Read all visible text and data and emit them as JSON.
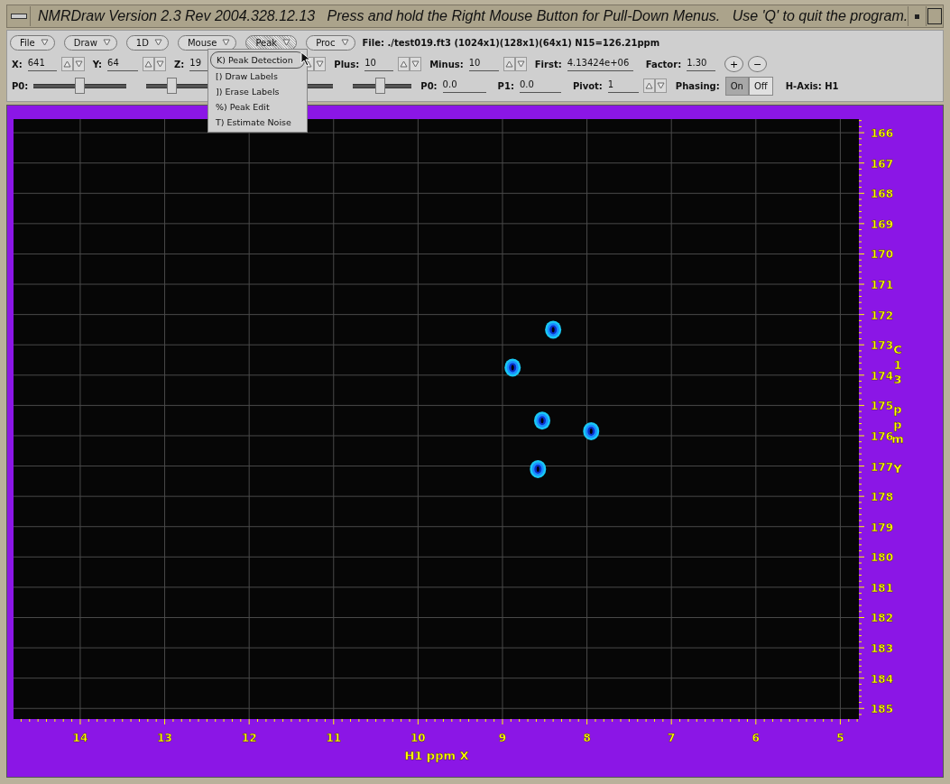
{
  "window": {
    "title": "NMRDraw Version 2.3 Rev 2004.328.12.13   Press and hold the Right Mouse Button for Pull-Down Menus.   Use 'Q' to quit the program."
  },
  "menus": [
    {
      "label": "File",
      "selected": false
    },
    {
      "label": "Draw",
      "selected": false
    },
    {
      "label": "1D",
      "selected": false
    },
    {
      "label": "Mouse",
      "selected": false
    },
    {
      "label": "Peak",
      "selected": true
    },
    {
      "label": "Proc",
      "selected": false
    }
  ],
  "file_info": "File: ./test019.ft3 (1024x1)(128x1)(64x1) N15=126.21ppm",
  "fields": [
    {
      "label": "X:",
      "value": "641",
      "spinner": true
    },
    {
      "label": "Y:",
      "value": "64",
      "spinner": true
    },
    {
      "label": "Z:",
      "value": "19",
      "spinner": true
    },
    {
      "label": "Plus:",
      "value": "10",
      "spinner": true
    },
    {
      "label": "Minus:",
      "value": "10",
      "spinner": true
    },
    {
      "label": "First:",
      "value": "4.13424e+06",
      "spinner": false
    },
    {
      "label": "Factor:",
      "value": "1.30",
      "spinner": false
    }
  ],
  "zoom_buttons": [
    "+",
    "−"
  ],
  "slider_label": "P0:",
  "sliders": [
    {
      "level": 0.49
    },
    {
      "level": 0.28
    },
    {
      "level": 0.46
    }
  ],
  "phase_fields": [
    {
      "label": "P0:",
      "value": "0.0",
      "spinner": false
    },
    {
      "label": "P1:",
      "value": "0.0",
      "spinner": false
    },
    {
      "label": "Pivot:",
      "value": "1",
      "spinner": true
    }
  ],
  "phasing": {
    "label": "Phasing:",
    "options": [
      {
        "label": "On",
        "selected": true
      },
      {
        "label": "Off",
        "selected": false
      }
    ]
  },
  "h_axis": "H-Axis: H1",
  "peak_menu": [
    {
      "label": "K) Peak Detection",
      "selected": true
    },
    {
      "label": "[) Draw Labels",
      "selected": false
    },
    {
      "label": "]) Erase Labels",
      "selected": false
    },
    {
      "label": "%) Peak Edit",
      "selected": false
    },
    {
      "label": "T) Estimate Noise",
      "selected": false
    }
  ],
  "spectrum": {
    "chart_data": {
      "type": "scatter",
      "xlabel": "H1 ppm X",
      "ylabel": "C13 ppm Y",
      "grid": true,
      "xlim": [
        14.79,
        4.78
      ],
      "ylim": [
        185.35,
        165.55
      ],
      "xticks": [
        14,
        13,
        12,
        11,
        10,
        9,
        8,
        7,
        6,
        5
      ],
      "yticks": [
        166,
        167,
        168,
        169,
        170,
        171,
        172,
        173,
        174,
        175,
        176,
        177,
        178,
        179,
        180,
        181,
        182,
        183,
        184,
        185
      ],
      "series": [
        {
          "color": "#1a8cff",
          "x": [
            8.4,
            8.88,
            8.53,
            8.58,
            7.95
          ],
          "values": [
            172.5,
            173.75,
            175.5,
            177.1,
            175.85
          ]
        }
      ]
    }
  }
}
